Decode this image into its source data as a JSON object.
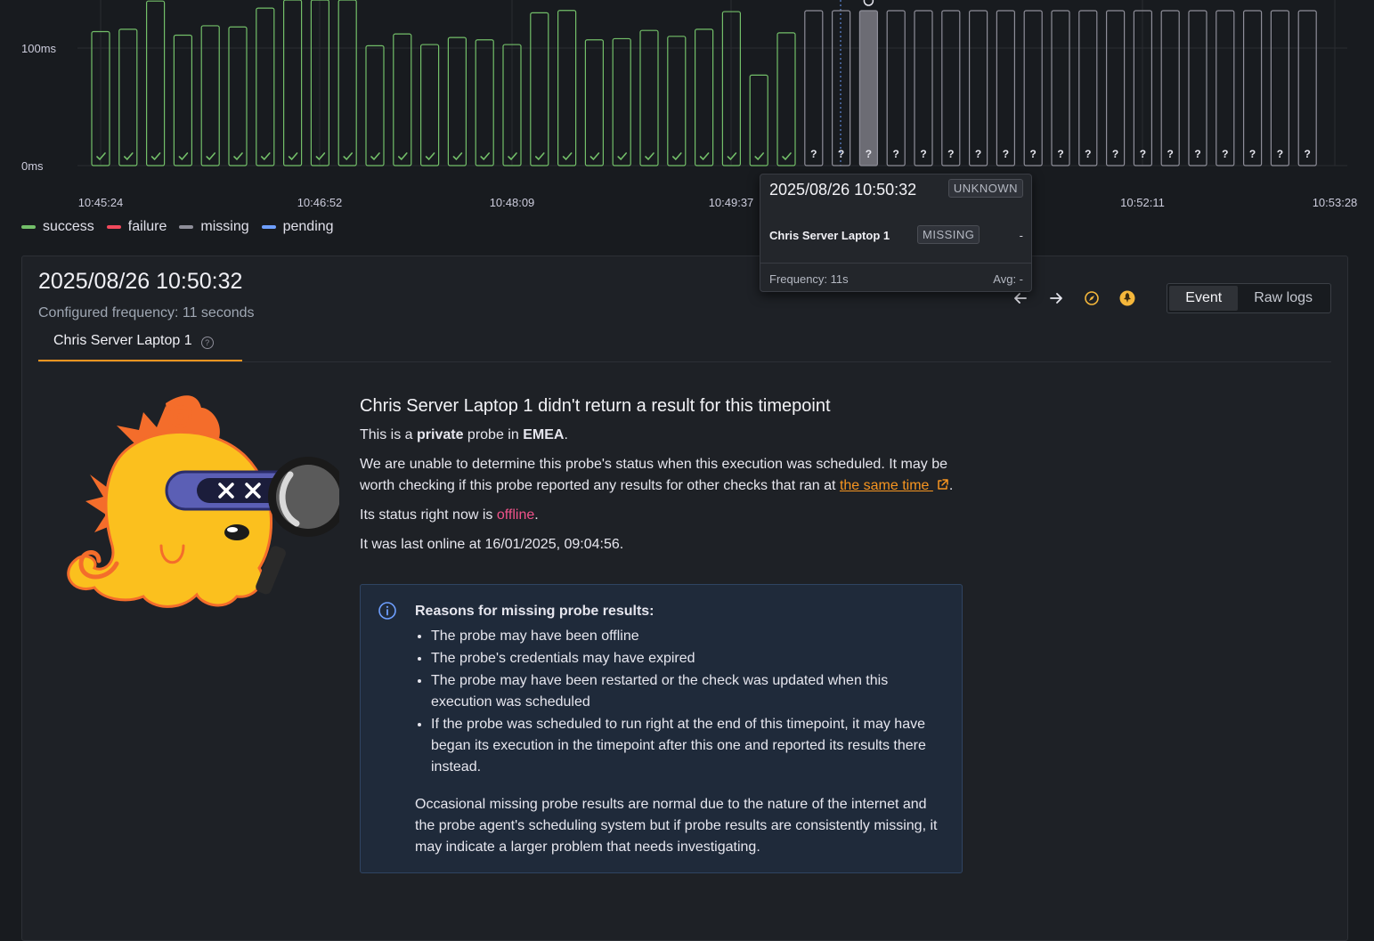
{
  "chart": {
    "y_labels": [
      "100ms",
      "0ms"
    ],
    "time_labels": [
      "10:45:24",
      "10:46:52",
      "10:48:09",
      "10:49:37",
      "10:52:11",
      "10:53:28"
    ],
    "success_color": "#73bf69",
    "missing_color": "#8e8e99",
    "missing_symbol": "?"
  },
  "chart_data": {
    "type": "bar",
    "ylabel": "",
    "ylim": [
      0,
      140
    ],
    "success_values": [
      114,
      116,
      140,
      111,
      119,
      118,
      134,
      145,
      150,
      143,
      102,
      112,
      103,
      109,
      107,
      103,
      130,
      132,
      107,
      108,
      115,
      110,
      116,
      131,
      77,
      113
    ],
    "missing_count": 19,
    "selected_index": 28
  },
  "legend": [
    {
      "label": "success",
      "color": "#73bf69"
    },
    {
      "label": "failure",
      "color": "#f2495c"
    },
    {
      "label": "missing",
      "color": "#8e8e99"
    },
    {
      "label": "pending",
      "color": "#6e9fff"
    }
  ],
  "panel": {
    "title": "2025/08/26 10:50:32",
    "subtitle": "Configured frequency: 11 seconds",
    "tab_label": "Chris Server Laptop 1",
    "help_symbol": "?",
    "toolbar": {
      "prev_icon": "arrow-left-icon",
      "next_icon": "arrow-right-icon",
      "explore_icon": "compass-icon",
      "probe_icon": "probe-icon",
      "event_label": "Event",
      "raw_logs_label": "Raw logs"
    }
  },
  "content": {
    "heading": "Chris Server Laptop 1 didn't return a result for this timepoint",
    "private_prefix": "This is a ",
    "private_bold": "private",
    "private_mid": " probe in ",
    "region": "EMEA",
    "period": ".",
    "unable_text": "We are unable to determine this probe's status when this execution was scheduled. It may be worth checking if this probe reported any results for other checks that ran at ",
    "same_time_link": "the same time",
    "status_prefix": "Its status right now is ",
    "status_value": "offline",
    "last_online": "It was last online at 16/01/2025, 09:04:56."
  },
  "info": {
    "title": "Reasons for missing probe results:",
    "reasons": [
      "The probe may have been offline",
      "The probe's credentials may have expired",
      "The probe may have been restarted or the check was updated when this execution was scheduled",
      "If the probe was scheduled to run right at the end of this timepoint, it may have began its execution in the timepoint after this one and reported its results there instead."
    ],
    "footnote": "Occasional missing probe results are normal due to the nature of the internet and the probe agent's scheduling system but if probe results are consistently missing, it may indicate a larger problem that needs investigating."
  },
  "tooltip": {
    "date": "2025/08/26 10:50:32",
    "status_badge": "UNKNOWN",
    "probe_name": "Chris Server Laptop 1",
    "probe_badge": "MISSING",
    "probe_value": "-",
    "frequency": "Frequency: 11s",
    "avg": "Avg: -"
  }
}
